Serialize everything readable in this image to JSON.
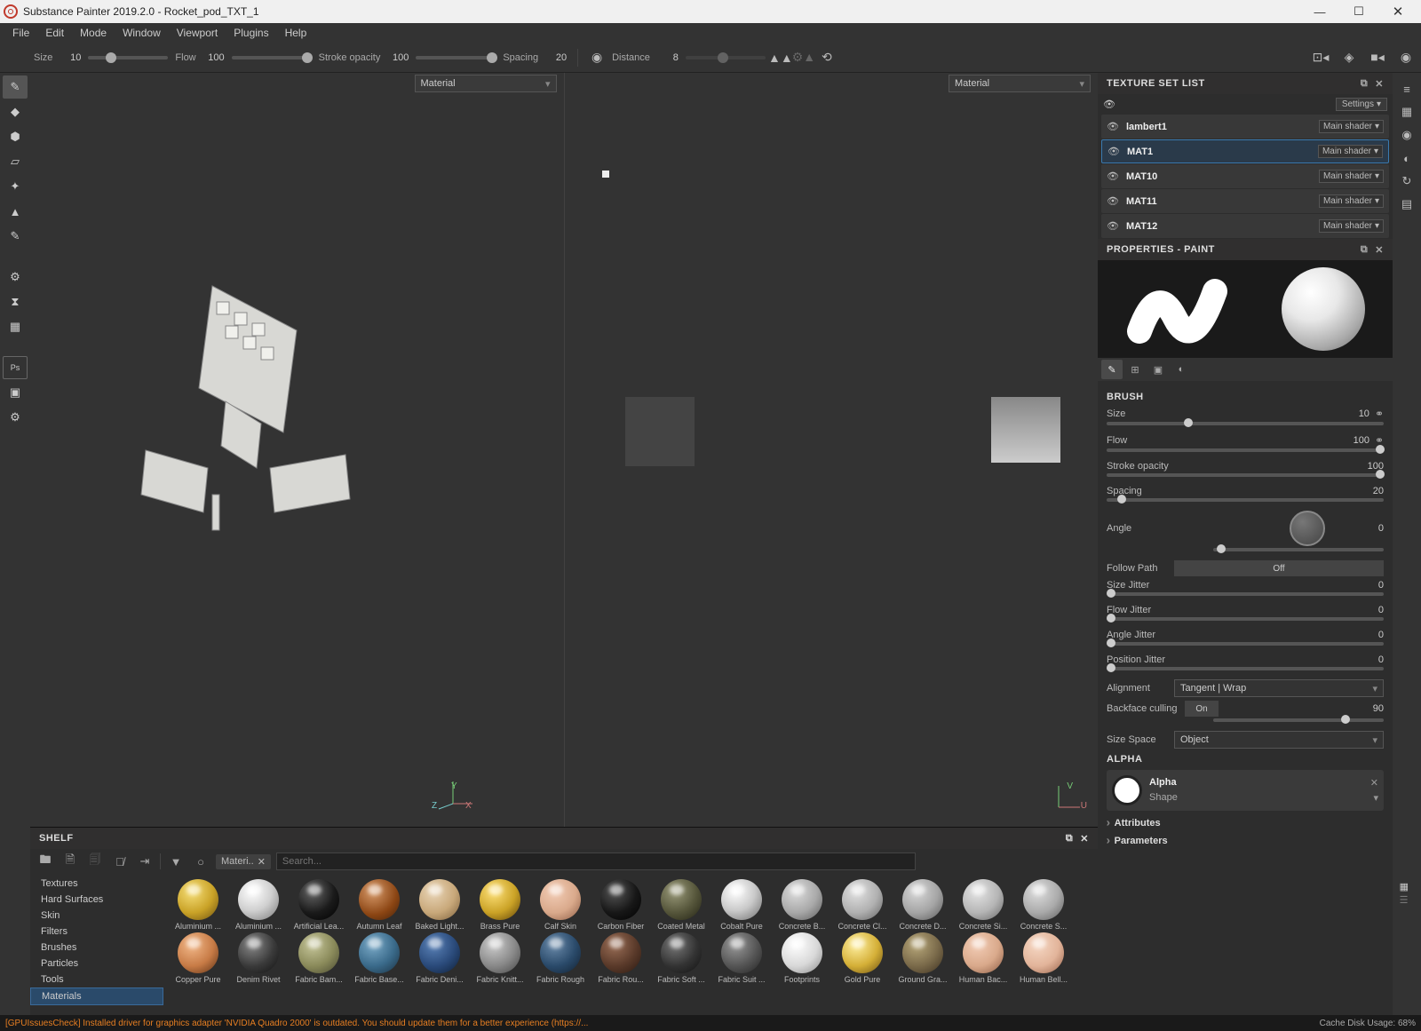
{
  "window": {
    "title": "Substance Painter 2019.2.0 - Rocket_pod_TXT_1"
  },
  "menu": [
    "File",
    "Edit",
    "Mode",
    "Window",
    "Viewport",
    "Plugins",
    "Help"
  ],
  "toolbar": {
    "size": {
      "label": "Size",
      "value": "10"
    },
    "flow": {
      "label": "Flow",
      "value": "100"
    },
    "stroke_opacity": {
      "label": "Stroke opacity",
      "value": "100"
    },
    "spacing": {
      "label": "Spacing",
      "value": "20"
    },
    "distance": {
      "label": "Distance",
      "value": "8"
    }
  },
  "viewport": {
    "material_label": "Material"
  },
  "shelf": {
    "title": "SHELF",
    "search_placeholder": "Search...",
    "tag": "Materi..",
    "categories": [
      "Textures",
      "Hard Surfaces",
      "Skin",
      "Filters",
      "Brushes",
      "Particles",
      "Tools",
      "Materials"
    ],
    "selected_category": "Materials",
    "materials": [
      {
        "name": "Aluminium ...",
        "color": "#c9a227",
        "r": "radial-gradient(circle at 35% 30%,#f7e07a,#c9a227 55%,#6a4e10)"
      },
      {
        "name": "Aluminium ...",
        "color": "#bbb",
        "r": "radial-gradient(circle at 35% 30%,#fff,#cfcfcf 50%,#777)"
      },
      {
        "name": "Artificial Lea...",
        "color": "#111",
        "r": "radial-gradient(circle at 35% 30%,#666,#1a1a1a 55%,#000)"
      },
      {
        "name": "Autumn Leaf",
        "color": "#a0522d",
        "r": "radial-gradient(circle at 35% 30%,#d89b6b,#8b4513 60%,#42210b)"
      },
      {
        "name": "Baked Light...",
        "color": "#c8a87a",
        "r": "radial-gradient(circle at 35% 30%,#ead6b8,#c8a87a 55%,#7a5e3a)"
      },
      {
        "name": "Brass Pure",
        "color": "#b8860b",
        "r": "radial-gradient(circle at 35% 30%,#ffe27a,#caa226 55%,#5a3e08)"
      },
      {
        "name": "Calf Skin",
        "color": "#d9a98b",
        "r": "radial-gradient(circle at 35% 30%,#f3cdb6,#d9a98b 55%,#8a5a42)"
      },
      {
        "name": "Carbon Fiber",
        "color": "#111",
        "r": "radial-gradient(circle at 35% 30%,#555,#171717 55%,#000)"
      },
      {
        "name": "Coated Metal",
        "color": "#555",
        "r": "radial-gradient(circle at 35% 30%,#9a9a7a,#55553a 55%,#222214)"
      },
      {
        "name": "Cobalt Pure",
        "color": "#aaa",
        "r": "radial-gradient(circle at 35% 30%,#fff,#c9c9c9 50%,#6a6a6a)"
      },
      {
        "name": "Concrete B...",
        "color": "#999",
        "r": "radial-gradient(circle at 35% 30%,#ddd,#a8a8a8 55%,#5a5a5a)"
      },
      {
        "name": "Concrete Cl...",
        "color": "#999",
        "r": "radial-gradient(circle at 35% 30%,#e2e2e2,#b0b0b0 55%,#606060)"
      },
      {
        "name": "Concrete D...",
        "color": "#999",
        "r": "radial-gradient(circle at 35% 30%,#d8d8d8,#a4a4a4 55%,#585858)"
      },
      {
        "name": "Concrete Si...",
        "color": "#999",
        "r": "radial-gradient(circle at 35% 30%,#e5e5e5,#b5b5b5 55%,#656565)"
      },
      {
        "name": "Concrete S...",
        "color": "#999",
        "r": "radial-gradient(circle at 35% 30%,#dedede,#aaaaaa 55%,#5c5c5c)"
      },
      {
        "name": "Copper Pure",
        "color": "#b87333",
        "r": "radial-gradient(circle at 35% 30%,#f3b98a,#c77b46 55%,#5a2f14)"
      },
      {
        "name": "Denim Rivet",
        "color": "#444",
        "r": "radial-gradient(circle at 35% 30%,#888,#3a3a3a 55%,#111)"
      },
      {
        "name": "Fabric Bam...",
        "color": "#8a8a5a",
        "r": "radial-gradient(circle at 35% 30%,#c6c69a,#8a8a5a 55%,#474730)"
      },
      {
        "name": "Fabric Base...",
        "color": "#3a6a8a",
        "r": "radial-gradient(circle at 35% 30%,#7aaac8,#3a6a8a 55%,#1a3040)"
      },
      {
        "name": "Fabric Deni...",
        "color": "#1a3a6a",
        "r": "radial-gradient(circle at 35% 30%,#5a82b8,#2a4a7a 55%,#0e1e36)"
      },
      {
        "name": "Fabric Knitt...",
        "color": "#888",
        "r": "radial-gradient(circle at 35% 30%,#ccc,#888 55%,#444)"
      },
      {
        "name": "Fabric Rough",
        "color": "#2a4a6a",
        "r": "radial-gradient(circle at 35% 30%,#6a8aaa,#2a4a6a 55%,#122030)"
      },
      {
        "name": "Fabric Rou...",
        "color": "#5a3a2a",
        "r": "radial-gradient(circle at 35% 30%,#9a6e56,#5a3a2a 55%,#2a1810)"
      },
      {
        "name": "Fabric Soft ...",
        "color": "#333",
        "r": "radial-gradient(circle at 35% 30%,#777,#333 55%,#111)"
      },
      {
        "name": "Fabric Suit ...",
        "color": "#555",
        "r": "radial-gradient(circle at 35% 30%,#999,#555 55%,#222)"
      },
      {
        "name": "Footprints",
        "color": "#ccc",
        "r": "radial-gradient(circle at 35% 30%,#fff,#d8d8d8 55%,#888)"
      },
      {
        "name": "Gold Pure",
        "color": "#d4af37",
        "r": "radial-gradient(circle at 35% 30%,#fff0a0,#d4af37 55%,#6a4e10)"
      },
      {
        "name": "Ground Gra...",
        "color": "#7a6a4a",
        "r": "radial-gradient(circle at 35% 30%,#b8a87a,#7a6a4a 55%,#3c3020)"
      },
      {
        "name": "Human Bac...",
        "color": "#d9a98b",
        "r": "radial-gradient(circle at 35% 30%,#f3cdb6,#d9a98b 55%,#8a5a42)"
      },
      {
        "name": "Human Bell...",
        "color": "#e2b49a",
        "r": "radial-gradient(circle at 35% 30%,#f6d8c4,#e2b49a 55%,#966048)"
      }
    ]
  },
  "status": {
    "warning": "[GPUIssuesCheck] Installed driver for graphics adapter 'NVIDIA Quadro 2000' is outdated. You should update them for a better experience (https://...",
    "cache": "Cache Disk Usage:  68%"
  },
  "texture_set": {
    "title": "TEXTURE SET LIST",
    "settings": "Settings",
    "shader": "Main shader",
    "items": [
      {
        "name": "lambert1"
      },
      {
        "name": "MAT1",
        "selected": true
      },
      {
        "name": "MAT10"
      },
      {
        "name": "MAT11"
      },
      {
        "name": "MAT12"
      }
    ]
  },
  "properties": {
    "title": "PROPERTIES - PAINT",
    "brush_label": "BRUSH",
    "size": {
      "label": "Size",
      "value": "10"
    },
    "flow": {
      "label": "Flow",
      "value": "100"
    },
    "stroke_opacity": {
      "label": "Stroke opacity",
      "value": "100"
    },
    "spacing": {
      "label": "Spacing",
      "value": "20"
    },
    "angle": {
      "label": "Angle",
      "value": "0"
    },
    "follow_path": {
      "label": "Follow Path",
      "value": "Off"
    },
    "size_jitter": {
      "label": "Size Jitter",
      "value": "0"
    },
    "flow_jitter": {
      "label": "Flow Jitter",
      "value": "0"
    },
    "angle_jitter": {
      "label": "Angle Jitter",
      "value": "0"
    },
    "position_jitter": {
      "label": "Position Jitter",
      "value": "0"
    },
    "alignment": {
      "label": "Alignment",
      "value": "Tangent | Wrap"
    },
    "backface": {
      "label": "Backface culling",
      "value": "On",
      "value2": "90"
    },
    "size_space": {
      "label": "Size Space",
      "value": "Object"
    },
    "alpha_section": "ALPHA",
    "alpha": {
      "name": "Alpha",
      "shape": "Shape"
    },
    "attributes": "Attributes",
    "parameters": "Parameters"
  }
}
